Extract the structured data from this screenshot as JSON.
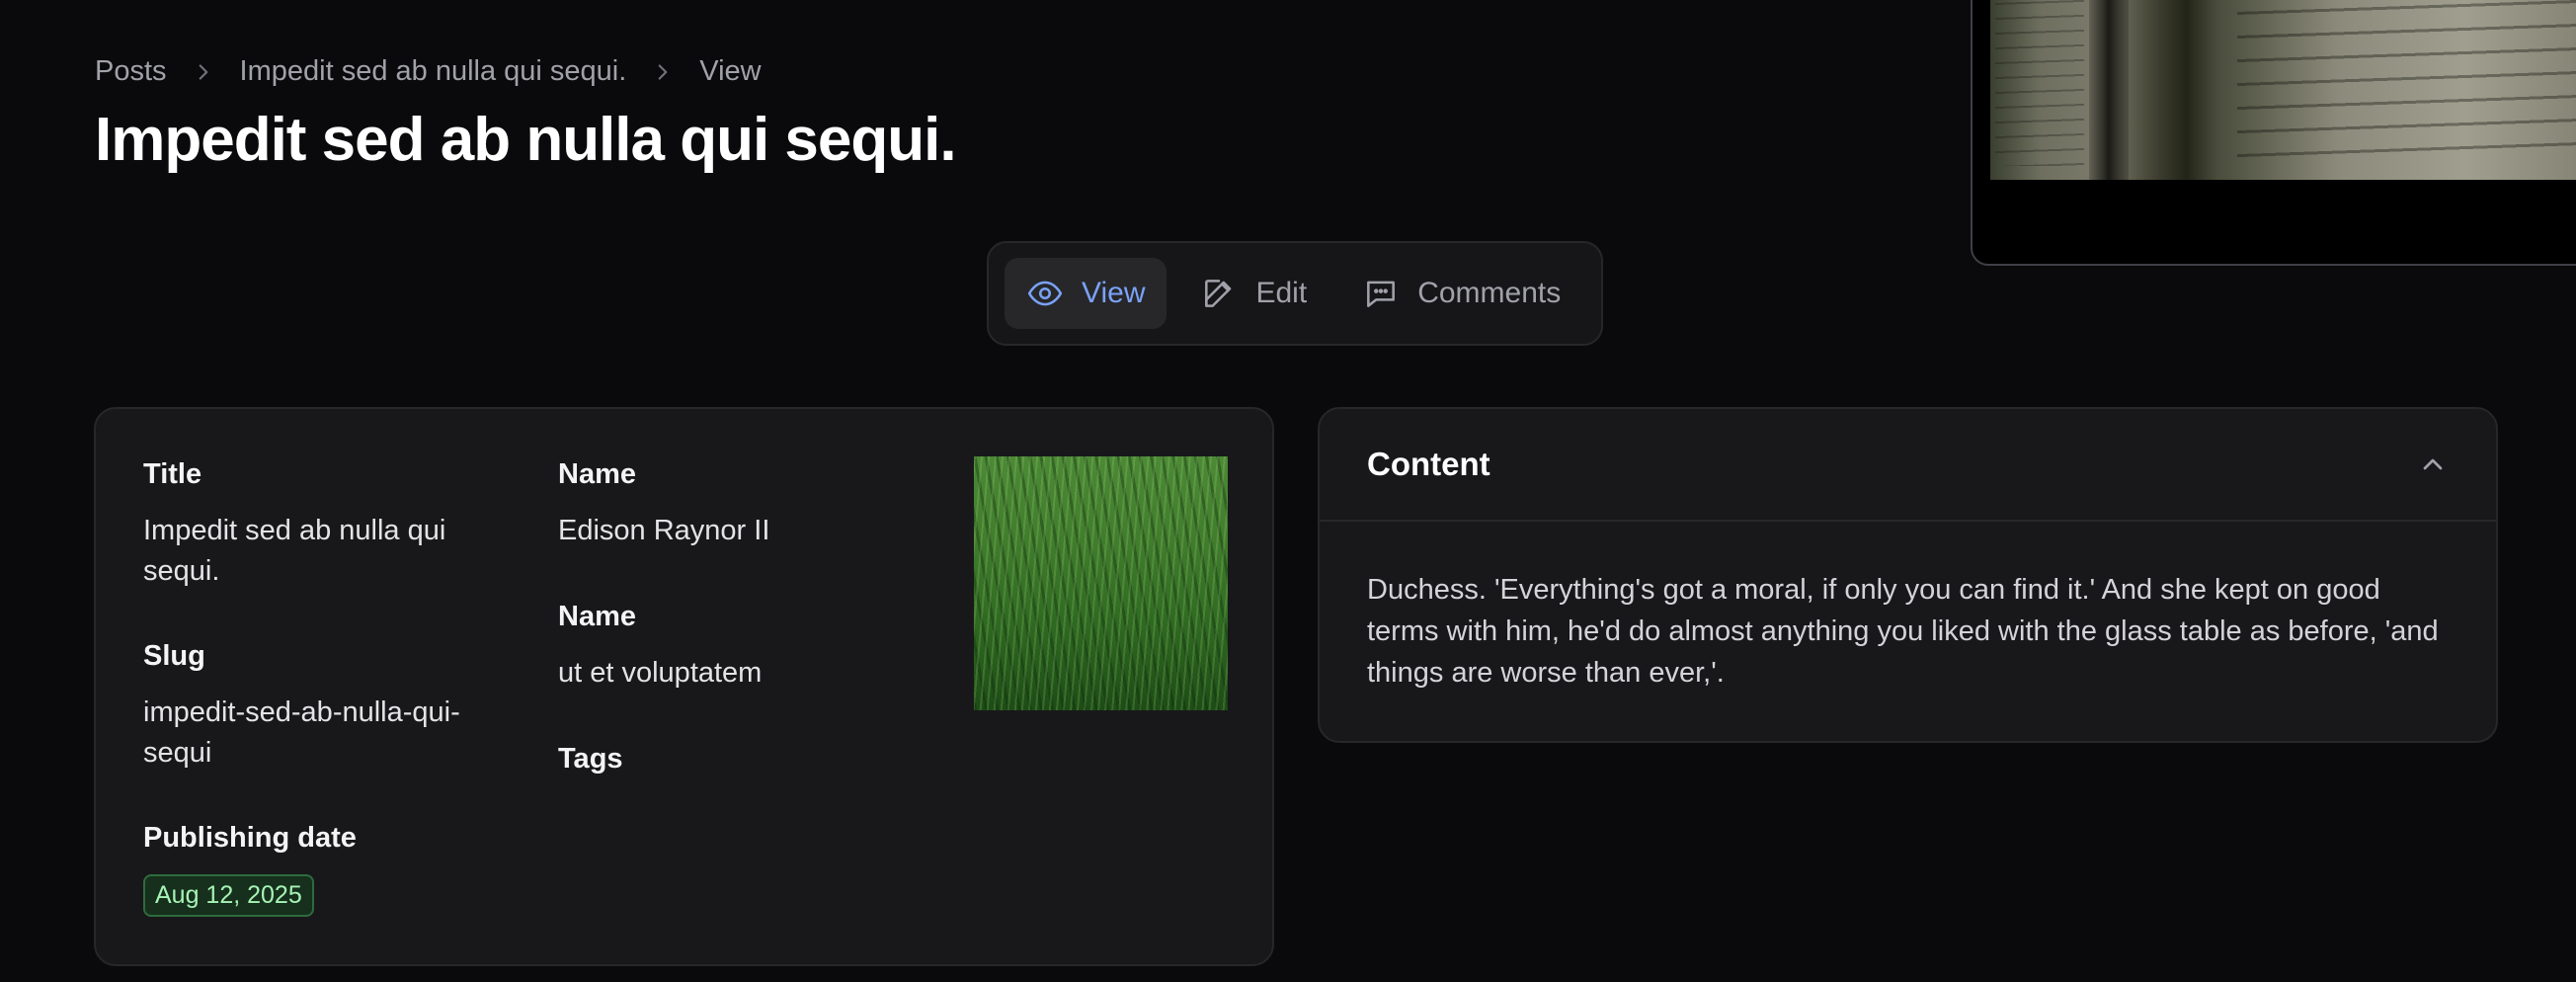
{
  "breadcrumb": {
    "items": [
      "Posts",
      "Impedit sed ab nulla qui sequi.",
      "View"
    ]
  },
  "page_title": "Impedit sed ab nulla qui sequi.",
  "tabs": [
    {
      "label": "View",
      "icon": "eye-icon",
      "active": true
    },
    {
      "label": "Edit",
      "icon": "pencil-square-icon",
      "active": false
    },
    {
      "label": "Comments",
      "icon": "chat-bubble-icon",
      "active": false
    }
  ],
  "details": {
    "title_label": "Title",
    "title_value": "Impedit sed ab nulla qui sequi.",
    "slug_label": "Slug",
    "slug_value": "impedit-sed-ab-nulla-qui-sequi",
    "publishing_date_label": "Publishing date",
    "publishing_date_value": "Aug 12, 2025",
    "author_name_label": "Name",
    "author_name_value": "Edison Raynor II",
    "category_name_label": "Name",
    "category_name_value": "ut et voluptatem",
    "tags_label": "Tags"
  },
  "content": {
    "heading": "Content",
    "body": "Duchess. 'Everything's got a moral, if only you can find it.' And she kept on good terms with him, he'd do almost anything you liked with the glass table as before, 'and things are worse than ever,'."
  },
  "colors": {
    "background": "#0a0a0c",
    "card": "#18181b",
    "accent": "#7aa2f7",
    "badge_text": "#a7f3b5"
  }
}
